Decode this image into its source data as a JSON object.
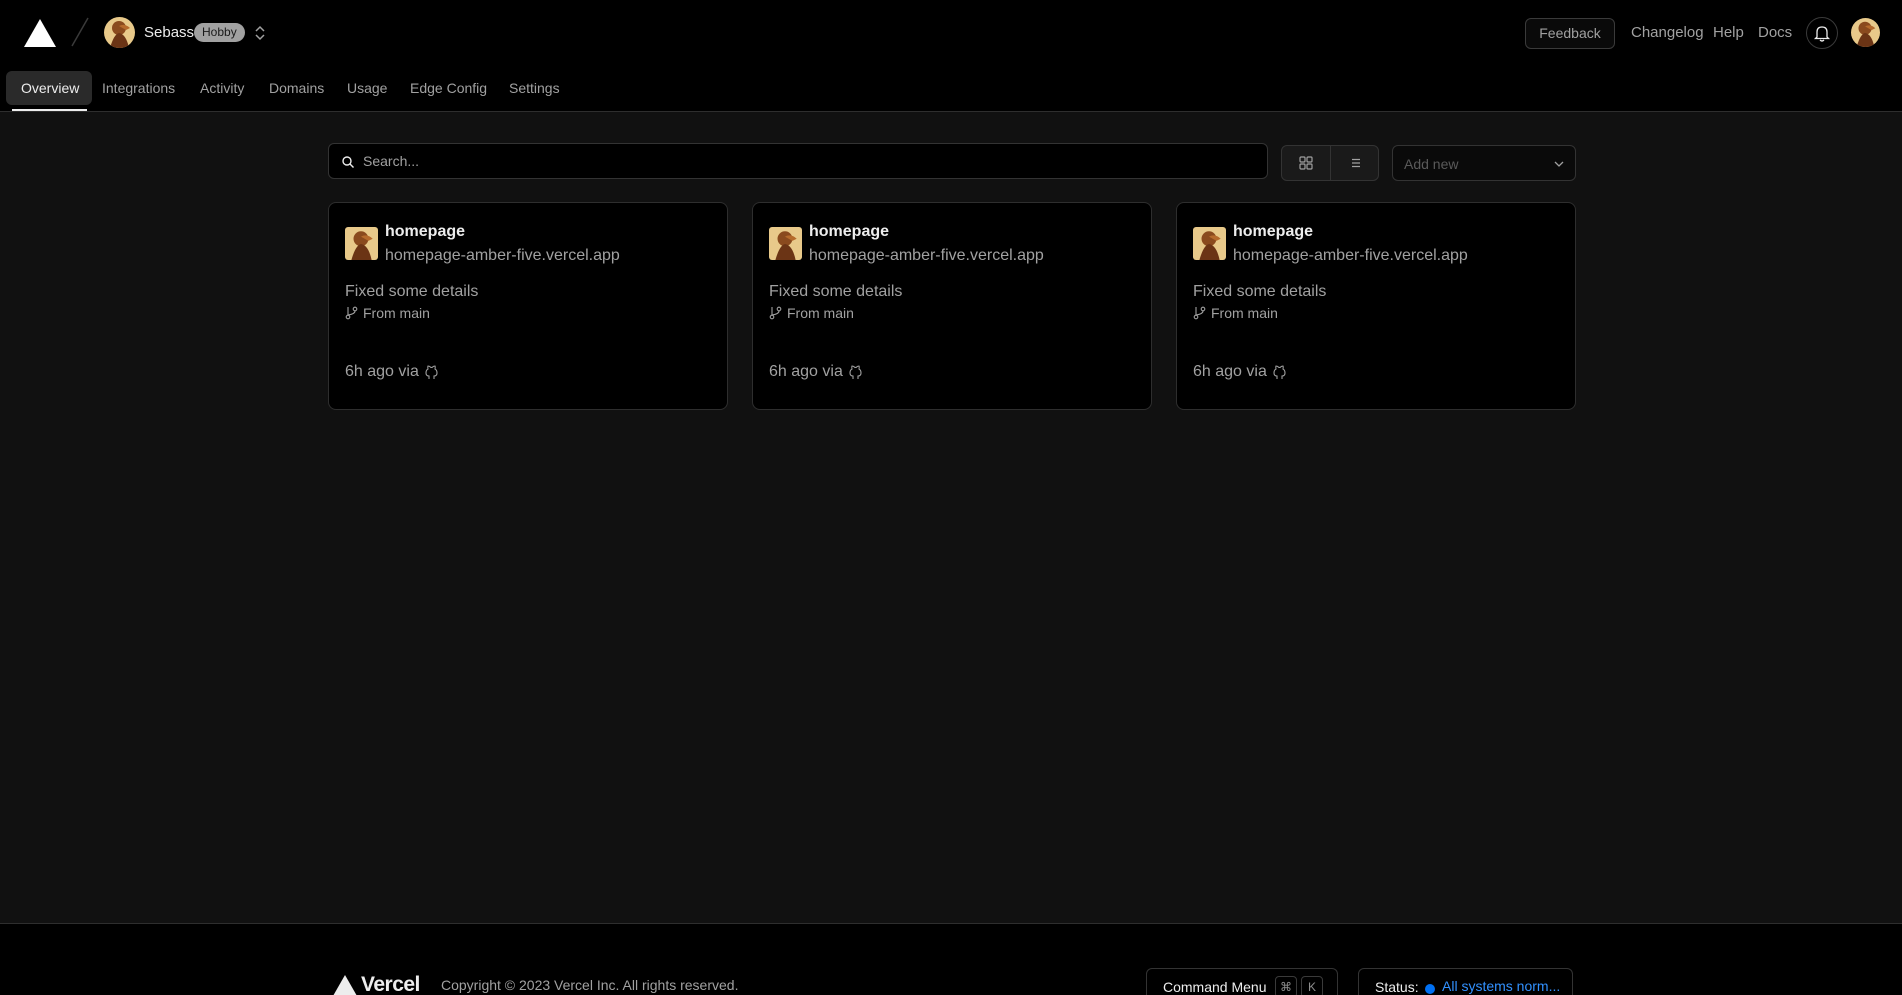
{
  "header": {
    "team_name": "Sebass",
    "plan_badge": "Hobby",
    "feedback_label": "Feedback",
    "links": [
      "Changelog",
      "Help",
      "Docs"
    ]
  },
  "tabs": [
    "Overview",
    "Integrations",
    "Activity",
    "Domains",
    "Usage",
    "Edge Config",
    "Settings"
  ],
  "toolbar": {
    "search_placeholder": "Search...",
    "add_new_label": "Add new"
  },
  "projects": [
    {
      "name": "homepage",
      "url": "homepage-amber-five.vercel.app",
      "commit": "Fixed some details",
      "branch": "From main",
      "time": "6h ago via"
    },
    {
      "name": "homepage",
      "url": "homepage-amber-five.vercel.app",
      "commit": "Fixed some details",
      "branch": "From main",
      "time": "6h ago via"
    },
    {
      "name": "homepage",
      "url": "homepage-amber-five.vercel.app",
      "commit": "Fixed some details",
      "branch": "From main",
      "time": "6h ago via"
    }
  ],
  "footer": {
    "logo_text": "Vercel",
    "copyright": "Copyright © 2023 Vercel Inc. All rights reserved.",
    "command_menu_label": "Command Menu",
    "command_keys": [
      "⌘",
      "K"
    ],
    "status_label": "Status:",
    "status_text": "All systems norm..."
  },
  "colors": {
    "background": "#111111",
    "surface": "#000000",
    "border": "#2e2e2e",
    "status_blue": "#0070f3"
  },
  "icons": {
    "logo": "vercel-triangle-icon",
    "switcher": "chevron-up-down-icon",
    "bell": "bell-icon",
    "search": "search-icon",
    "grid_view": "grid-icon",
    "list_view": "list-icon",
    "add_new": "chevron-down-icon",
    "branch": "git-branch-icon",
    "github": "github-icon"
  }
}
